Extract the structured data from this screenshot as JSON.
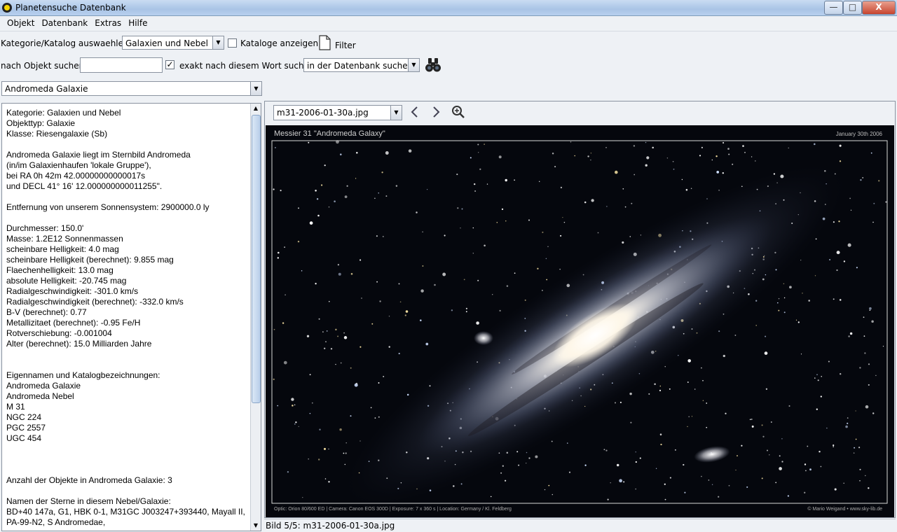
{
  "window": {
    "title": "Planetensuche Datenbank",
    "minimize": "—",
    "maximize": "□",
    "close": "X"
  },
  "menu": [
    "Objekt",
    "Datenbank",
    "Extras",
    "Hilfe"
  ],
  "toolbar1": {
    "category_label": "Kategorie/Katalog auswaehlen:",
    "category_value": "Galaxien und Nebel",
    "show_catalogs_label": "Kataloge anzeigen",
    "show_catalogs_checked": false,
    "filter_label": "Filter"
  },
  "toolbar2": {
    "search_label": "nach Objekt suchen:",
    "search_value": "",
    "exact_label": "exakt nach diesem Wort suchen",
    "exact_checked": true,
    "scope_value": "in der Datenbank suchen"
  },
  "object_select": "Andromeda Galaxie",
  "info_lines": [
    "Kategorie: Galaxien und Nebel",
    "Objekttyp: Galaxie",
    "Klasse: Riesengalaxie (Sb)",
    "",
    "Andromeda Galaxie liegt im Sternbild Andromeda",
    "(in/im Galaxienhaufen 'lokale Gruppe'),",
    "bei RA 0h 42m 42.00000000000017s",
    "und DECL 41° 16' 12.000000000011255\".",
    "",
    "Entfernung von unserem Sonnensystem: 2900000.0 ly",
    "",
    "Durchmesser: 150.0'",
    "Masse: 1.2E12 Sonnenmassen",
    "scheinbare Helligkeit: 4.0 mag",
    "scheinbare Helligkeit (berechnet): 9.855 mag",
    "Flaechenhelligkeit: 13.0 mag",
    "absolute Helligkeit: -20.745 mag",
    "Radialgeschwindigkeit: -301.0 km/s",
    "Radialgeschwindigkeit (berechnet): -332.0 km/s",
    "B-V (berechnet): 0.77",
    "Metallizitaet (berechnet): -0.95 Fe/H",
    "Rotverschiebung: -0.001004",
    "Alter (berechnet): 15.0 Milliarden Jahre",
    "",
    "",
    "Eigennamen und Katalogbezeichnungen:",
    "Andromeda Galaxie",
    "Andromeda Nebel",
    "M 31",
    "NGC 224",
    "PGC 2557",
    "UGC 454",
    "",
    "",
    "",
    "Anzahl der Objekte in Andromeda Galaxie: 3",
    "",
    "Namen der Sterne in diesem Nebel/Galaxie:",
    "BD+40 147a, G1, HBK 0-1, M31GC J003247+393440, Mayall II,",
    "PA-99-N2, S Andromedae,"
  ],
  "image_viewer": {
    "file_select": "m31-2006-01-30a.jpg",
    "photo_title": "Messier 31   \"Andromeda Galaxy\"",
    "photo_date": "January 30th 2006",
    "photo_footer_left": "Optic: Orion 80/600 ED   |   Camera: Canon EOS 300D   |   Exposure: 7 x 360 s   |   Location: Germany / Kl. Feldberg",
    "photo_footer_right": "© Mario Weigand • www.sky-lib.de"
  },
  "status": "Bild 5/5: m31-2006-01-30a.jpg",
  "colors": {
    "accent": "#3a6ea5",
    "panel_bg": "#eef1f5",
    "sky": "#05070d"
  }
}
